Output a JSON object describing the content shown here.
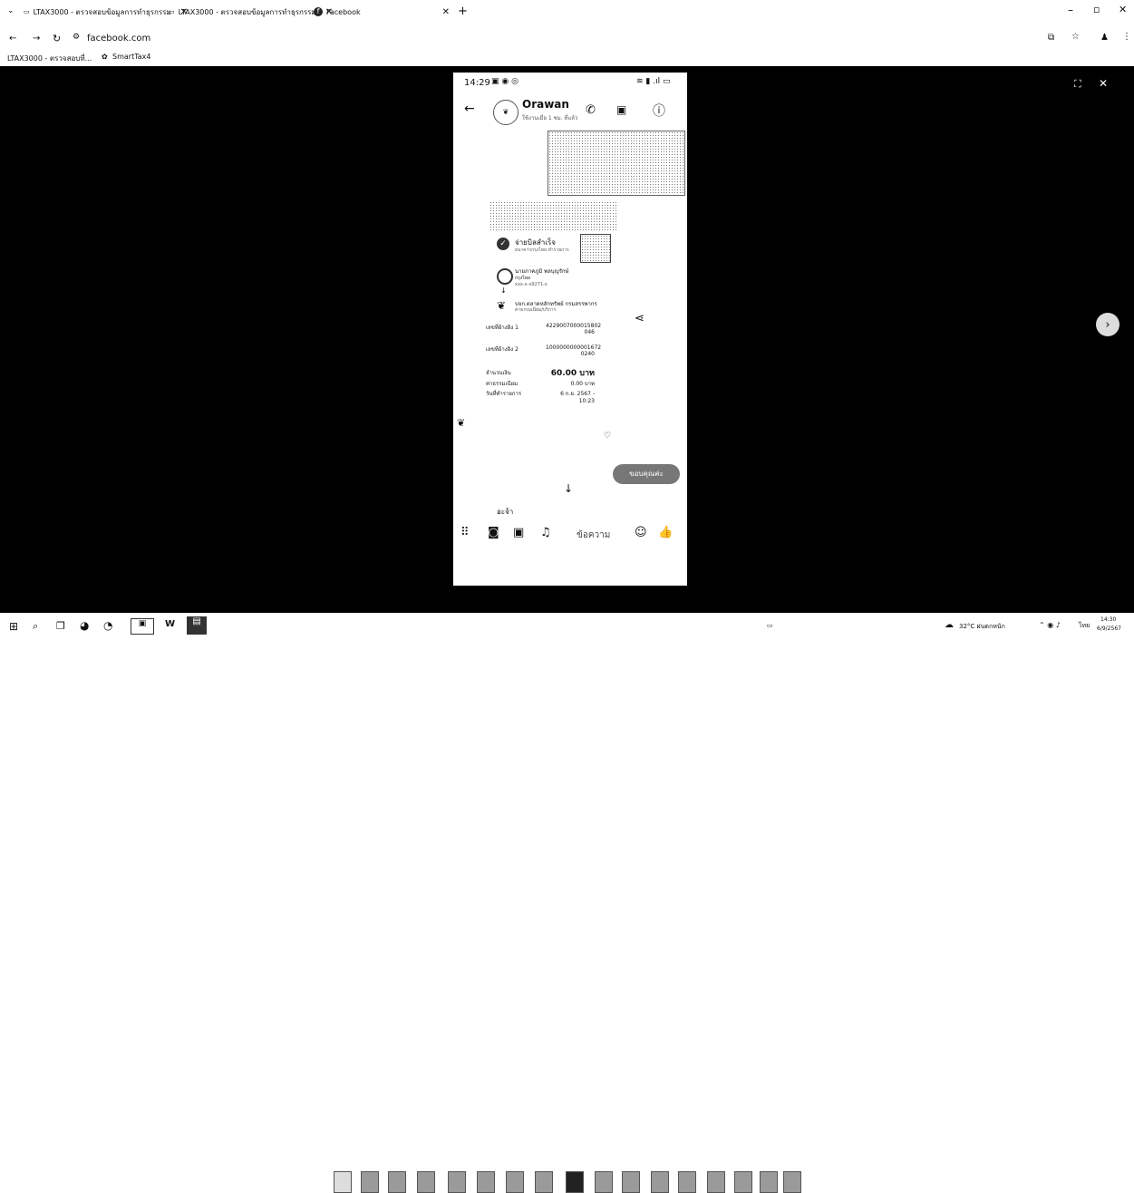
{
  "browser": {
    "tabs": [
      {
        "label": "LTAX3000 - ตรวจสอบข้อมูลการทำธุรกรรม"
      },
      {
        "label": "LTAX3000 - ตรวจสอบข้อมูลการทำธุรกรรม"
      },
      {
        "label": "Facebook"
      }
    ],
    "new_tab": "+",
    "url": "facebook.com",
    "bookmarks": [
      {
        "label": "LTAX3000 - ตรวจสอบที่..."
      },
      {
        "label": "SmartTax4"
      }
    ]
  },
  "phone": {
    "status_time": "14:29",
    "contact_name": "Orawan",
    "contact_sub": "ใช้งานเมื่อ 1 ชม. ที่แล้ว",
    "slip": {
      "status": "จ่ายบิลสำเร็จ",
      "status_sub": "ธนาคารกรุงไทย ทำรายการ",
      "payer_name": "นายภาคภูมิ พลบุญรักษ์",
      "payer_bank": "กรุงไทย",
      "payer_acct": "xxx-x-x9271-x",
      "payee_name": "บจก.ตลาดหลักทรัพย์ กรมสรรพากร",
      "payee_sub": "ค่าธรรมเนียม/บริการ",
      "rows": [
        {
          "label": "เลขที่อ้างอิง 1",
          "value": "4229007000015802 046"
        },
        {
          "label": "เลขที่อ้างอิง 2",
          "value": "1000000000001672 0240"
        },
        {
          "label": "จำนวนเงิน",
          "value": "60.00 บาท"
        },
        {
          "label": "ค่าธรรมเนียม",
          "value": "0.00 บาท"
        },
        {
          "label": "วันที่ทำรายการ",
          "value": "6 ก.ย. 2567 - 10:23"
        }
      ]
    },
    "pill_button": "ขอบคุณค่ะ",
    "reply_text": "อะจ้า",
    "composer_placeholder": "ข้อความ"
  },
  "taskbar": {
    "tray_text": "32°C ฝนตกหนัก",
    "lang": "ไทย",
    "time": "14:30",
    "date": "6/9/2567"
  }
}
